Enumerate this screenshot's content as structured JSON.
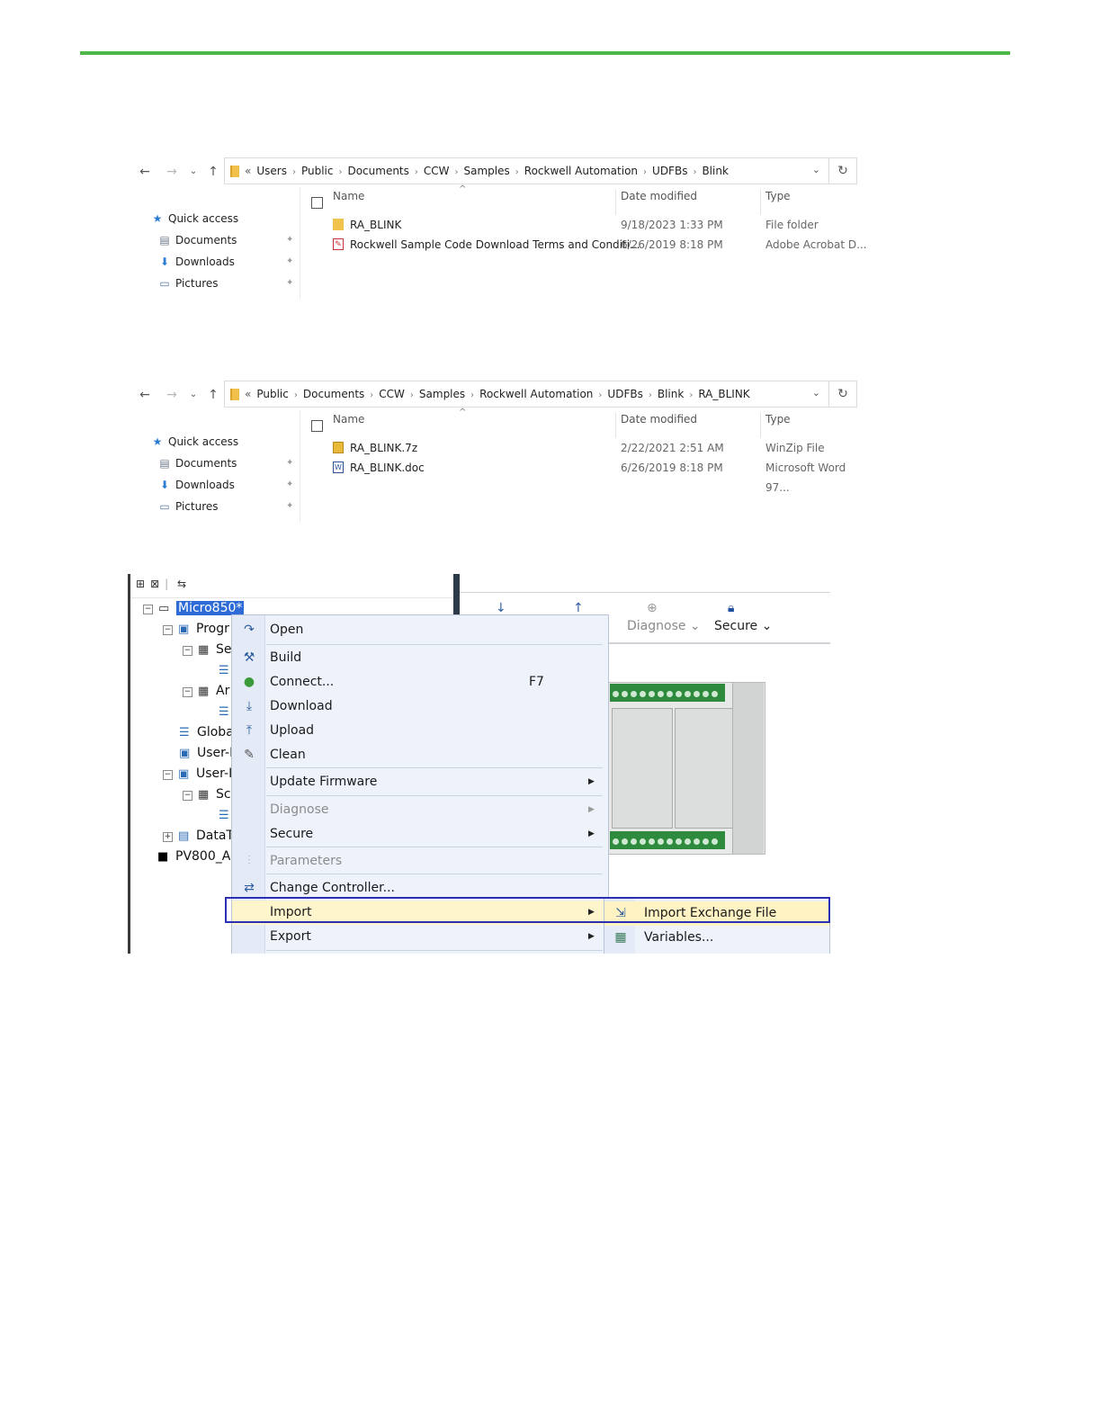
{
  "explorer1": {
    "breadcrumb_lead": "«",
    "breadcrumbs": [
      "Users",
      "Public",
      "Documents",
      "CCW",
      "Samples",
      "Rockwell Automation",
      "UDFBs",
      "Blink"
    ],
    "sidebar": [
      {
        "label": "Quick access",
        "icon": "star-icon"
      },
      {
        "label": "Documents",
        "icon": "documents-icon"
      },
      {
        "label": "Downloads",
        "icon": "downloads-icon"
      },
      {
        "label": "Pictures",
        "icon": "pictures-icon"
      }
    ],
    "columns": {
      "name": "Name",
      "date": "Date modified",
      "type": "Type"
    },
    "files": [
      {
        "name": "RA_BLINK",
        "date": "9/18/2023 1:33 PM",
        "type": "File folder",
        "icon": "folder-icon"
      },
      {
        "name": "Rockwell Sample Code Download Terms and Conditi...",
        "date": "6/26/2019 8:18 PM",
        "type": "Adobe Acrobat D...",
        "icon": "pdf-icon"
      }
    ]
  },
  "explorer2": {
    "breadcrumb_lead": "«",
    "breadcrumbs": [
      "Public",
      "Documents",
      "CCW",
      "Samples",
      "Rockwell Automation",
      "UDFBs",
      "Blink",
      "RA_BLINK"
    ],
    "sidebar": [
      {
        "label": "Quick access",
        "icon": "star-icon"
      },
      {
        "label": "Documents",
        "icon": "documents-icon"
      },
      {
        "label": "Downloads",
        "icon": "downloads-icon"
      },
      {
        "label": "Pictures",
        "icon": "pictures-icon"
      }
    ],
    "columns": {
      "name": "Name",
      "date": "Date modified",
      "type": "Type"
    },
    "files": [
      {
        "name": "RA_BLINK.7z",
        "date": "2/22/2021 2:51 AM",
        "type": "WinZip File",
        "icon": "zip-icon"
      },
      {
        "name": "RA_BLINK.doc",
        "date": "6/26/2019 8:18 PM",
        "type": "Microsoft Word 97...",
        "icon": "word-icon"
      }
    ]
  },
  "ccw": {
    "tree": [
      {
        "label": "Micro850*",
        "selected": true
      },
      {
        "label": "Progr"
      },
      {
        "label": "Se"
      },
      {
        "label": "Ar"
      },
      {
        "label": "Globa"
      },
      {
        "label": "User-I"
      },
      {
        "label": "User-I"
      },
      {
        "label": "Sc"
      },
      {
        "label": "DataT"
      },
      {
        "label": "PV800_Ap"
      }
    ],
    "toolbar": {
      "diagnose": "Diagnose",
      "secure": "Secure"
    },
    "menu": {
      "open": "Open",
      "build": "Build",
      "connect": "Connect...",
      "connect_key": "F7",
      "download": "Download",
      "upload": "Upload",
      "clean": "Clean",
      "update_firmware": "Update Firmware",
      "diagnose": "Diagnose",
      "secure": "Secure",
      "parameters": "Parameters",
      "change_controller": "Change Controller...",
      "import": "Import",
      "export": "Export"
    },
    "submenu": {
      "import_exchange_file": "Import Exchange File",
      "variables": "Variables..."
    },
    "colors": {
      "accent_rule": "#4db848",
      "highlight_box": "#2b2fb5",
      "menu_highlight": "#fff5cc"
    }
  }
}
